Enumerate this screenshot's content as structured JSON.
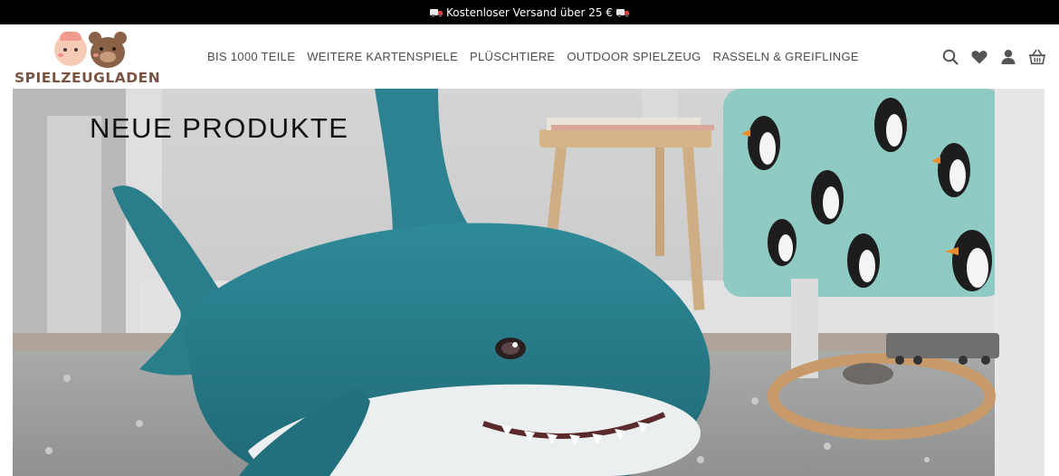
{
  "promo": {
    "text": "Kostenloser Versand über 25 €"
  },
  "brand": {
    "name": "SPIELZEUGLADEN"
  },
  "nav": {
    "items": [
      {
        "label": "BIS 1000 TEILE"
      },
      {
        "label": "WEITERE KARTENSPIELE"
      },
      {
        "label": "PLÜSCHTIERE"
      },
      {
        "label": "OUTDOOR SPIELZEUG"
      },
      {
        "label": "RASSELN & GREIFLINGE"
      }
    ]
  },
  "header_icons": [
    "search-icon",
    "heart-icon",
    "user-icon",
    "basket-icon"
  ],
  "hero": {
    "title": "NEUE PRODUKTE"
  },
  "colors": {
    "promo_bg": "#000000",
    "brand": "#7a5443",
    "nav_text": "#4d4d4d",
    "shark": "#2a7f8f"
  }
}
